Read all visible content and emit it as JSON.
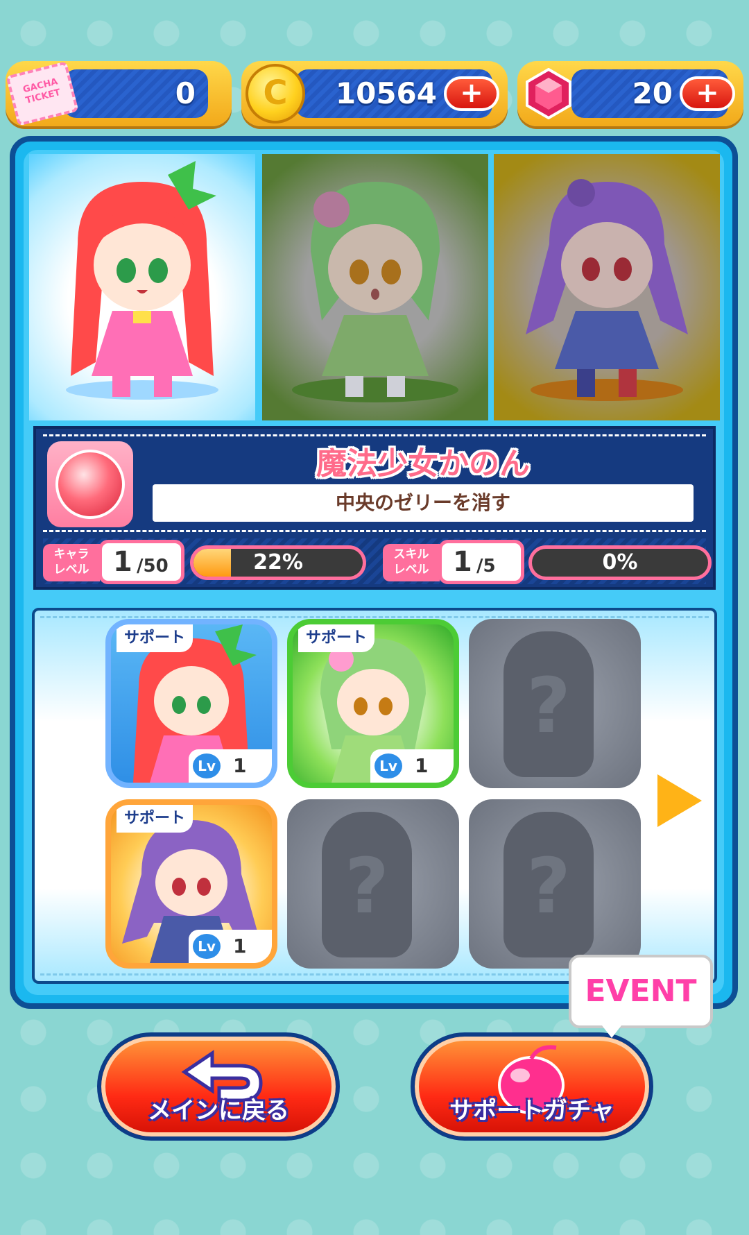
{
  "currencies": {
    "ticket": {
      "icon": "gacha-ticket-icon",
      "value": "0",
      "icon_text": "GACHA TICKET"
    },
    "coins": {
      "icon": "coin-icon",
      "value": "10564"
    },
    "gems": {
      "icon": "gem-icon",
      "value": "20"
    }
  },
  "party": [
    {
      "slot": 1,
      "selected": true,
      "hair_color": "#ff4a4a"
    },
    {
      "slot": 2,
      "selected": false,
      "hair_color": "#6fbf6f"
    },
    {
      "slot": 3,
      "selected": false,
      "hair_color": "#8b63c4"
    }
  ],
  "character": {
    "name": "魔法少女かのん",
    "skill_description": "中央のゼリーを消す",
    "char_level_label_1": "キャラ",
    "char_level_label_2": "レベル",
    "char_level": "1",
    "char_level_max": "/50",
    "char_progress": "22%",
    "char_progress_value": 0.22,
    "skill_level_label_1": "スキル",
    "skill_level_label_2": "レベル",
    "skill_level": "1",
    "skill_level_max": "/5",
    "skill_progress": "0%",
    "skill_progress_value": 0
  },
  "support": {
    "badge_label": "サポート",
    "lv_label": "Lv",
    "cards": [
      {
        "theme": "red",
        "level": "1",
        "locked": false
      },
      {
        "theme": "green",
        "level": "1",
        "locked": false
      },
      {
        "theme": "locked",
        "locked": true
      },
      {
        "theme": "orange",
        "level": "1",
        "locked": false
      },
      {
        "theme": "locked",
        "locked": true
      },
      {
        "theme": "locked",
        "locked": true
      }
    ]
  },
  "buttons": {
    "back": "メインに戻る",
    "gacha": "サポートガチャ",
    "event_badge": "EVENT"
  },
  "colors": {
    "background": "#8ad6d2",
    "panel": "#1bb8ef",
    "accent_pink": "#ff6f9d",
    "navy": "#153a80"
  }
}
